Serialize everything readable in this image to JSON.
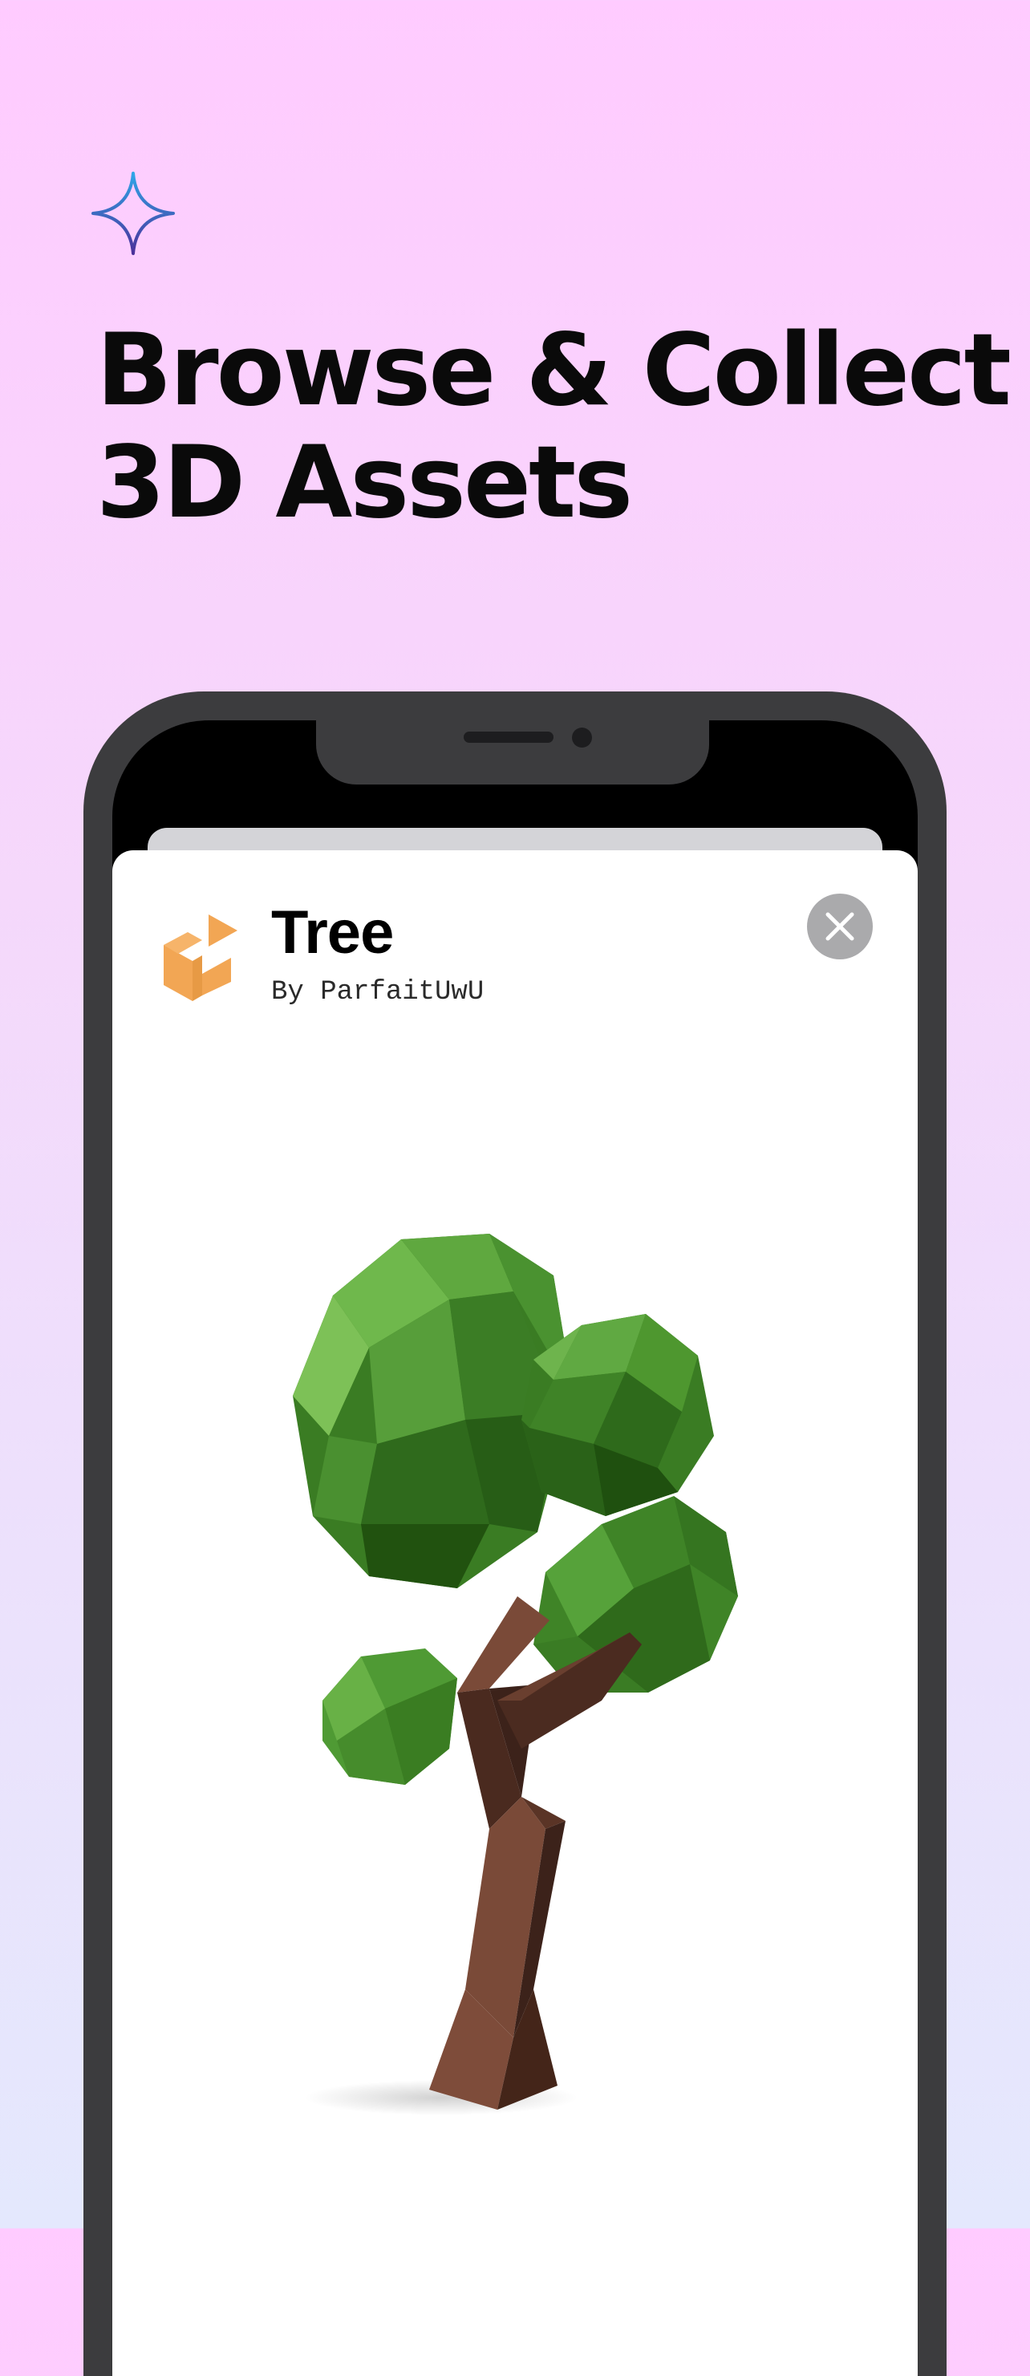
{
  "hero": {
    "headline_line1": "Browse & Collect",
    "headline_line2": "3D Assets",
    "icon": "sparkle-icon",
    "icon_colors": [
      "#2fa6e8",
      "#4b2f9a"
    ]
  },
  "asset": {
    "title": "Tree",
    "author": "By ParfaitUwU",
    "logo_icon": "package-logo-icon",
    "logo_color": "#f2a654",
    "close_icon": "close-icon",
    "preview": "tree-model"
  },
  "colors": {
    "bg_top": "#ffcbff",
    "bg_bottom": "#e4e8fd",
    "phone_frame": "#3c3c3e",
    "close_button": "#aaaaac"
  }
}
